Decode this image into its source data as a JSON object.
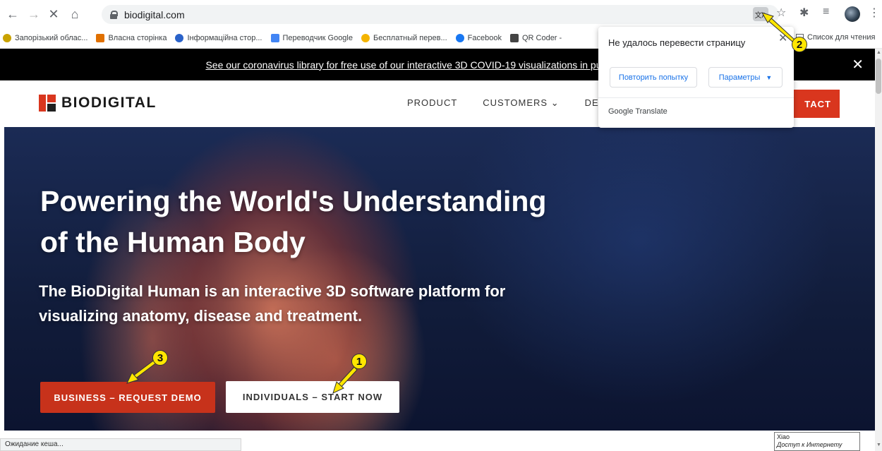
{
  "browser": {
    "url": "biodigital.com",
    "bookmarks": [
      {
        "label": "Запорізький облас...",
        "color": "#c9a200"
      },
      {
        "label": "Власна сторінка",
        "color": "#e07000"
      },
      {
        "label": "Інформаційна стор...",
        "color": "#2a62c9"
      },
      {
        "label": "Переводчик Google",
        "color": "#4285f4"
      },
      {
        "label": "Бесплатный перев...",
        "color": "#f4b400"
      },
      {
        "label": "Facebook",
        "color": "#1877f2"
      },
      {
        "label": "QR Coder -",
        "color": "#444444"
      }
    ],
    "reading_list": "Список для чтения",
    "status_text": "Ожидание кеша...",
    "tooltip_line1": "Xiao",
    "tooltip_line2": "Доступ к Интернету"
  },
  "translate_popup": {
    "title": "Не удалось перевести страницу",
    "retry_label": "Повторить попытку",
    "options_label": "Параметры",
    "footer": "Google Translate"
  },
  "site": {
    "banner_text": "See our coronavirus library for free use of our interactive 3D COVID-19 visualizations in pu",
    "logo_text": "BIODIGITAL",
    "nav": {
      "product": "PRODUCT",
      "customers": "CUSTOMERS",
      "dev": "DEV"
    },
    "contact_label": "TACT",
    "hero_title": "Powering the World's Understanding of the Human Body",
    "hero_subtitle": "The BioDigital Human is an interactive 3D software platform for visualizing anatomy, disease and treatment.",
    "demo_button": "BUSINESS – REQUEST DEMO",
    "start_button": "INDIVIDUALS – START NOW"
  },
  "annotations": {
    "one": "1",
    "two": "2",
    "three": "3"
  },
  "colors": {
    "brand": "#d9361e",
    "highlight": "#ffe600"
  }
}
